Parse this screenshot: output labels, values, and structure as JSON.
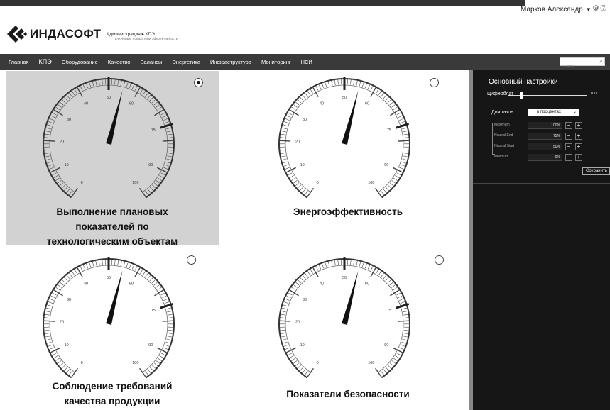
{
  "user": {
    "name": "Марков Александр",
    "caret": "▼",
    "icons": "⚙⑦"
  },
  "logo": {
    "brand": "ИНДАСОФТ"
  },
  "breadcrumb": {
    "line1": "Администрация ▸ КПЭ",
    "line2": "ключевые показатели эффективности"
  },
  "nav": {
    "items": [
      "Главная",
      "КПЭ",
      "Оборудование",
      "Качество",
      "Балансы",
      "Энергетика",
      "Инфраструктура",
      "Мониторинг",
      "НСИ"
    ],
    "search_placeholder": "Поиск",
    "search_icon": "⌕"
  },
  "gauge": {
    "tick_labels": [
      "0",
      "10",
      "20",
      "30",
      "40",
      "50",
      "60",
      "75",
      "90",
      "100"
    ]
  },
  "tiles": [
    {
      "title_lines": [
        "Выполнение плановых",
        "показателей по",
        "технологическим объектам"
      ],
      "selected": true,
      "value": 55
    },
    {
      "title_lines": [
        "Энергоэффективность"
      ],
      "selected": false,
      "value": 55
    },
    {
      "title_lines": [
        "Соблюдение требований",
        "качества продукции"
      ],
      "selected": false,
      "value": 55
    },
    {
      "title_lines": [
        "Показатели безопасности"
      ],
      "selected": false,
      "value": 55
    }
  ],
  "settings": {
    "header": "Основный настройки",
    "dial_label": "Циферблат",
    "dial_value": "100",
    "dial_level": 0.15,
    "range_label": "Диапазон",
    "range_value": "в процентах",
    "range_chevron": "⌄",
    "rows": [
      {
        "label": "Maximum",
        "value": "100%"
      },
      {
        "label": "Neutral End",
        "value": "75%"
      },
      {
        "label": "Neutral Start",
        "value": "50%"
      },
      {
        "label": "Minimum",
        "value": "0%"
      }
    ],
    "minus": "−",
    "plus": "+",
    "save": "Сохранить"
  }
}
